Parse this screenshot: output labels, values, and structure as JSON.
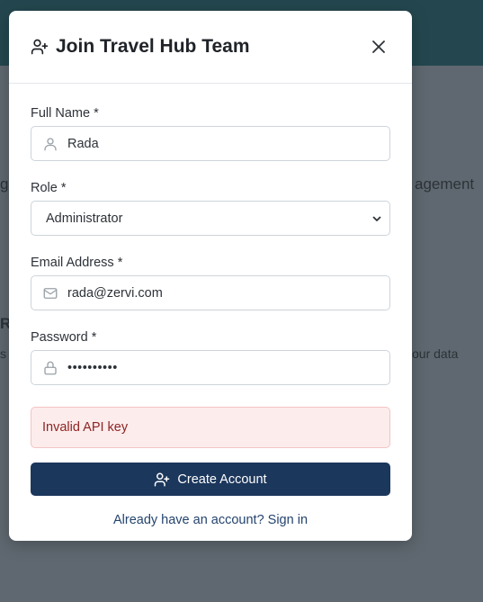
{
  "modal": {
    "title": "Join Travel Hub Team",
    "fields": {
      "full_name": {
        "label": "Full Name *",
        "value": "Rada"
      },
      "role": {
        "label": "Role *",
        "value": "Administrator"
      },
      "email": {
        "label": "Email Address *",
        "value": "rada@zervi.com"
      },
      "password": {
        "label": "Password *",
        "value": "••••••••••"
      }
    },
    "error": "Invalid API key",
    "submit_label": "Create Account",
    "signin_text": "Already have an account? Sign in"
  },
  "background": {
    "fragments": [
      "agement",
      "R",
      "our data",
      "g",
      "s"
    ]
  },
  "colors": {
    "header": "#24474f",
    "overlay": "#5f6870",
    "primary_button": "#1c375c",
    "error_bg": "#fdecec",
    "error_text": "#8e2424",
    "link": "#24446e"
  },
  "icons": {
    "title": "user-plus-icon",
    "close": "close-icon",
    "full_name": "user-icon",
    "email": "mail-icon",
    "password": "lock-icon",
    "submit": "user-plus-icon"
  }
}
